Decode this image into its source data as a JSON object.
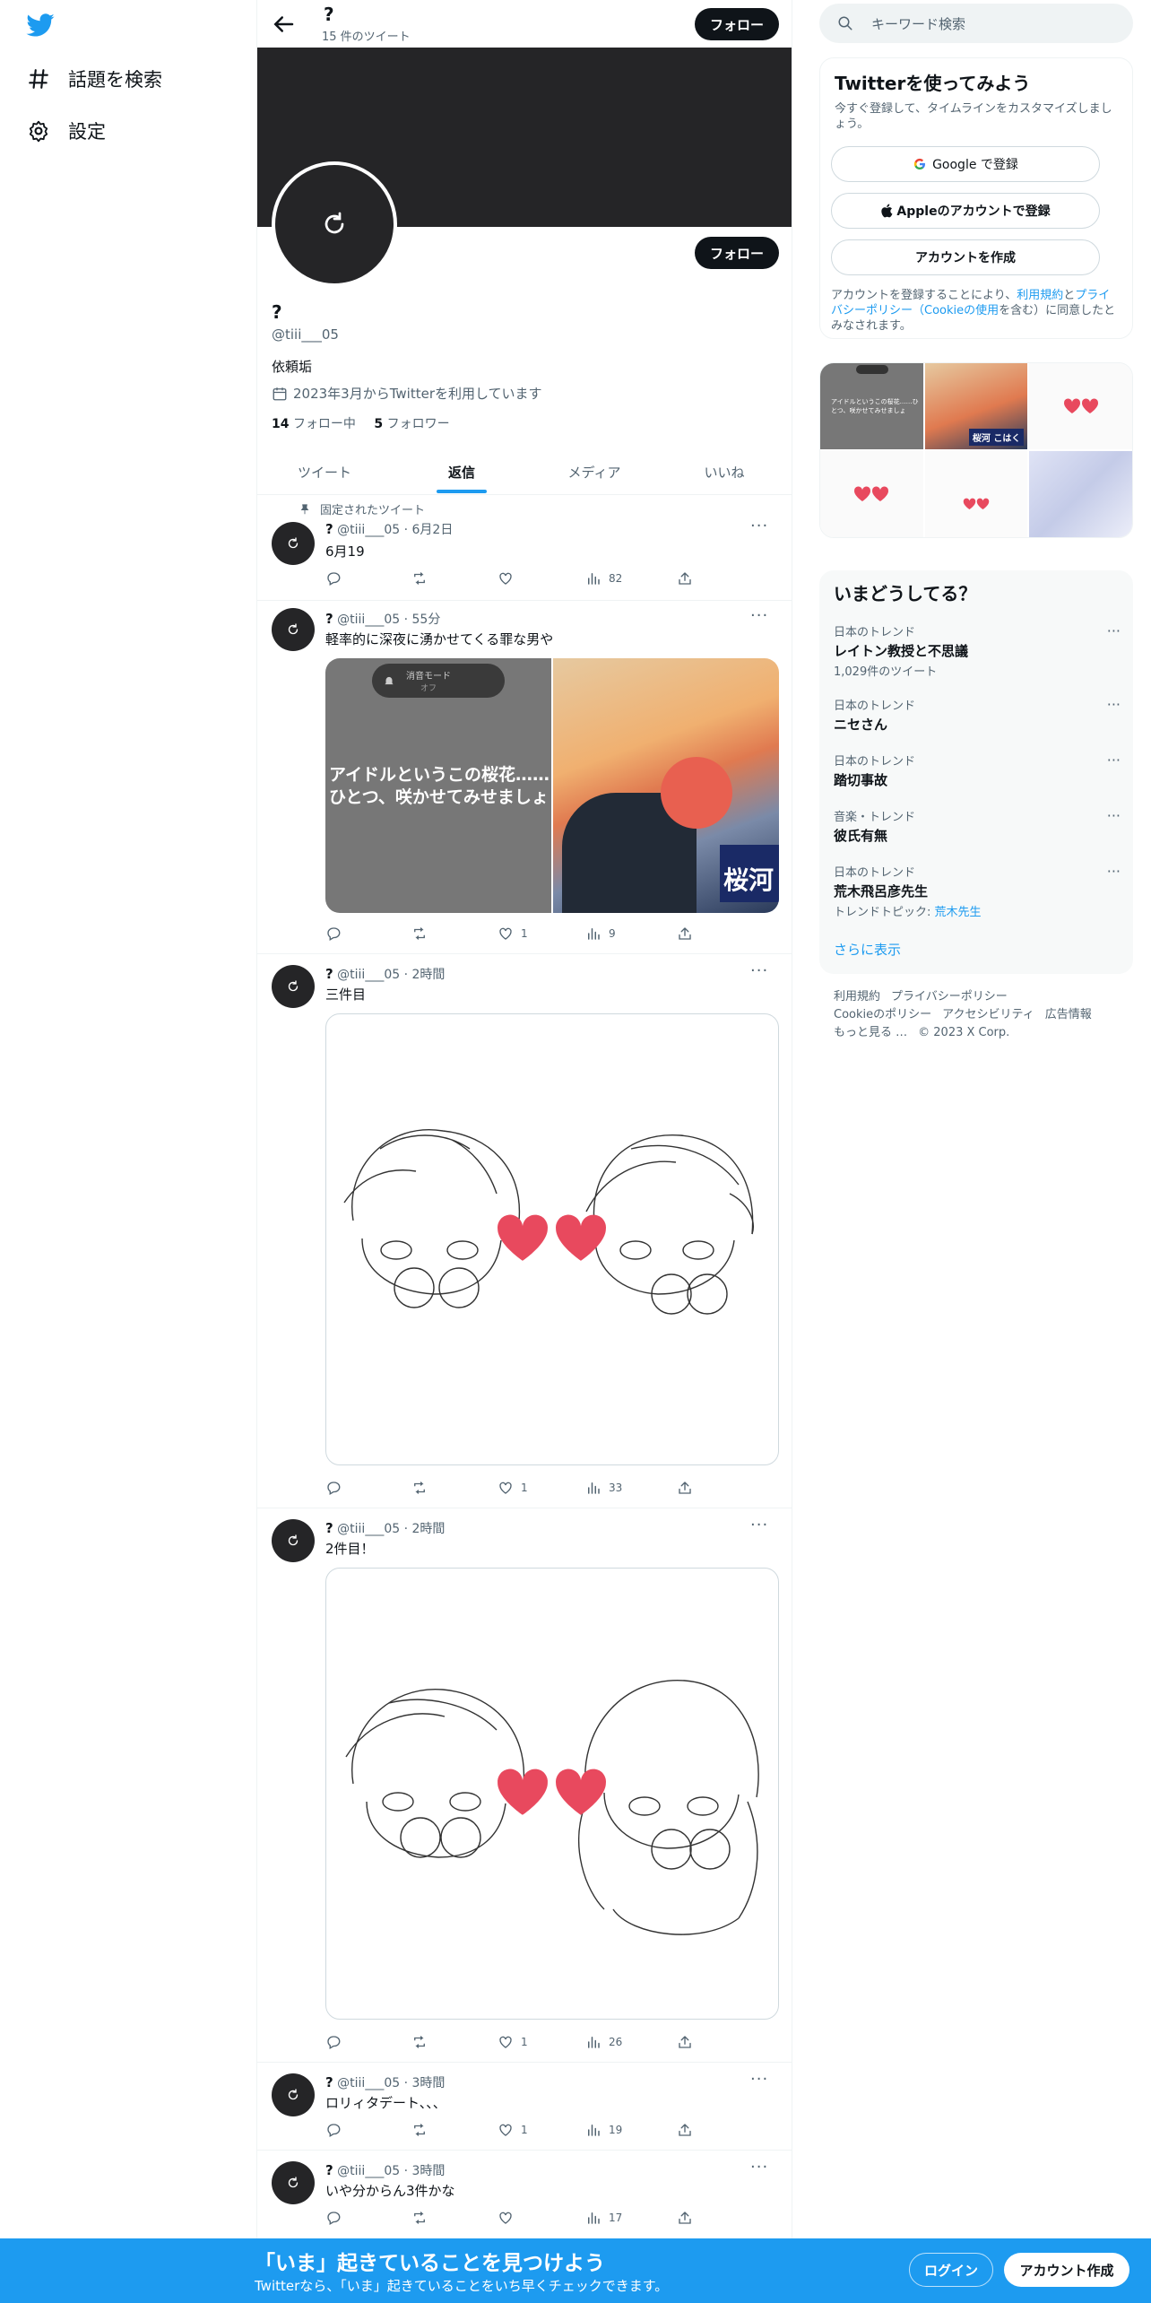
{
  "left_nav": {
    "explore_label": "話題を検索",
    "settings_label": "設定"
  },
  "topbar": {
    "name": "?",
    "tweet_count": "15 件のツイート",
    "follow_label": "フォロー"
  },
  "profile": {
    "name": "?",
    "handle": "@tiii___05",
    "bio": "依頼垢",
    "joined": "2023年3月からTwitterを利用しています",
    "following_count": "14",
    "following_label": "フォロー中",
    "followers_count": "5",
    "followers_label": "フォロワー",
    "follow_label": "フォロー"
  },
  "tabs": [
    "ツイート",
    "返信",
    "メディア",
    "いいね"
  ],
  "pinned_label": "固定されたツイート",
  "tweets": [
    {
      "name": "?",
      "handle": "@tiii___05",
      "time": "6月2日",
      "text": "6月19",
      "likes": "",
      "views": "82"
    },
    {
      "name": "?",
      "handle": "@tiii___05",
      "time": "55分",
      "text": "軽率的に深夜に湧かせてくる罪な男や",
      "likes": "1",
      "views": "9",
      "media_text_1": "アイドルというこの桜花……",
      "media_text_2": "ひとつ、咲かせてみせましょ",
      "media_notice": "消音モード",
      "media_notice_sub": "オフ",
      "media_banner": "桜河"
    },
    {
      "name": "?",
      "handle": "@tiii___05",
      "time": "2時間",
      "text": "三件目",
      "likes": "1",
      "views": "33"
    },
    {
      "name": "?",
      "handle": "@tiii___05",
      "time": "2時間",
      "text": "2件目！",
      "likes": "1",
      "views": "26"
    },
    {
      "name": "?",
      "handle": "@tiii___05",
      "time": "3時間",
      "text": "ロリィタデート、、、",
      "likes": "1",
      "views": "19"
    },
    {
      "name": "?",
      "handle": "@tiii___05",
      "time": "3時間",
      "text": "いや分からん3件かな",
      "likes": "",
      "views": "17"
    }
  ],
  "right": {
    "search_placeholder": "キーワード検索",
    "signup_title": "Twitterを使ってみよう",
    "signup_sub": "今すぐ登録して、タイムラインをカスタマイズしましょう。",
    "google_label": "Google で登録",
    "apple_label": "Appleのアカウントで登録",
    "create_label": "アカウントを作成",
    "legal_pre": "アカウントを登録することにより、",
    "legal_terms": "利用規約",
    "legal_and": "と",
    "legal_privacy": "プライバシーポリシー",
    "legal_cookie": "（Cookieの使用",
    "legal_post": "を含む）に同意したとみなされます。",
    "gallery_text": "アイドルというこの桜花……ひとつ、咲かせてみせましょ",
    "gallery_banner": "桜河 こはく",
    "trends_title": "いまどうしてる？",
    "trends": [
      {
        "context": "日本のトレンド",
        "name": "レイトン教授と不思議",
        "count": "1,029件のツイート"
      },
      {
        "context": "日本のトレンド",
        "name": "ニセさん",
        "count": ""
      },
      {
        "context": "日本のトレンド",
        "name": "踏切事故",
        "count": ""
      },
      {
        "context": "音楽・トレンド",
        "name": "彼氏有無",
        "count": ""
      },
      {
        "context": "日本のトレンド",
        "name": "荒木飛呂彦先生",
        "count": "",
        "topic_label": "トレンドトピック:",
        "topic": "荒木先生"
      }
    ],
    "show_more": "さらに表示",
    "footer": [
      "利用規約",
      "プライバシーポリシー",
      "Cookieのポリシー",
      "アクセシビリティ",
      "広告情報",
      "もっと見る …",
      "© 2023 X Corp."
    ]
  },
  "bottom_bar": {
    "title": "「いま」起きていることを見つけよう",
    "sub": "Twitterなら、「いま」起きていることをいち早くチェックできます。",
    "login": "ログイン",
    "signup": "アカウント作成"
  },
  "colors": {
    "accent": "#1d9bf0",
    "heart": "#e8495e",
    "banner": "#252527"
  }
}
